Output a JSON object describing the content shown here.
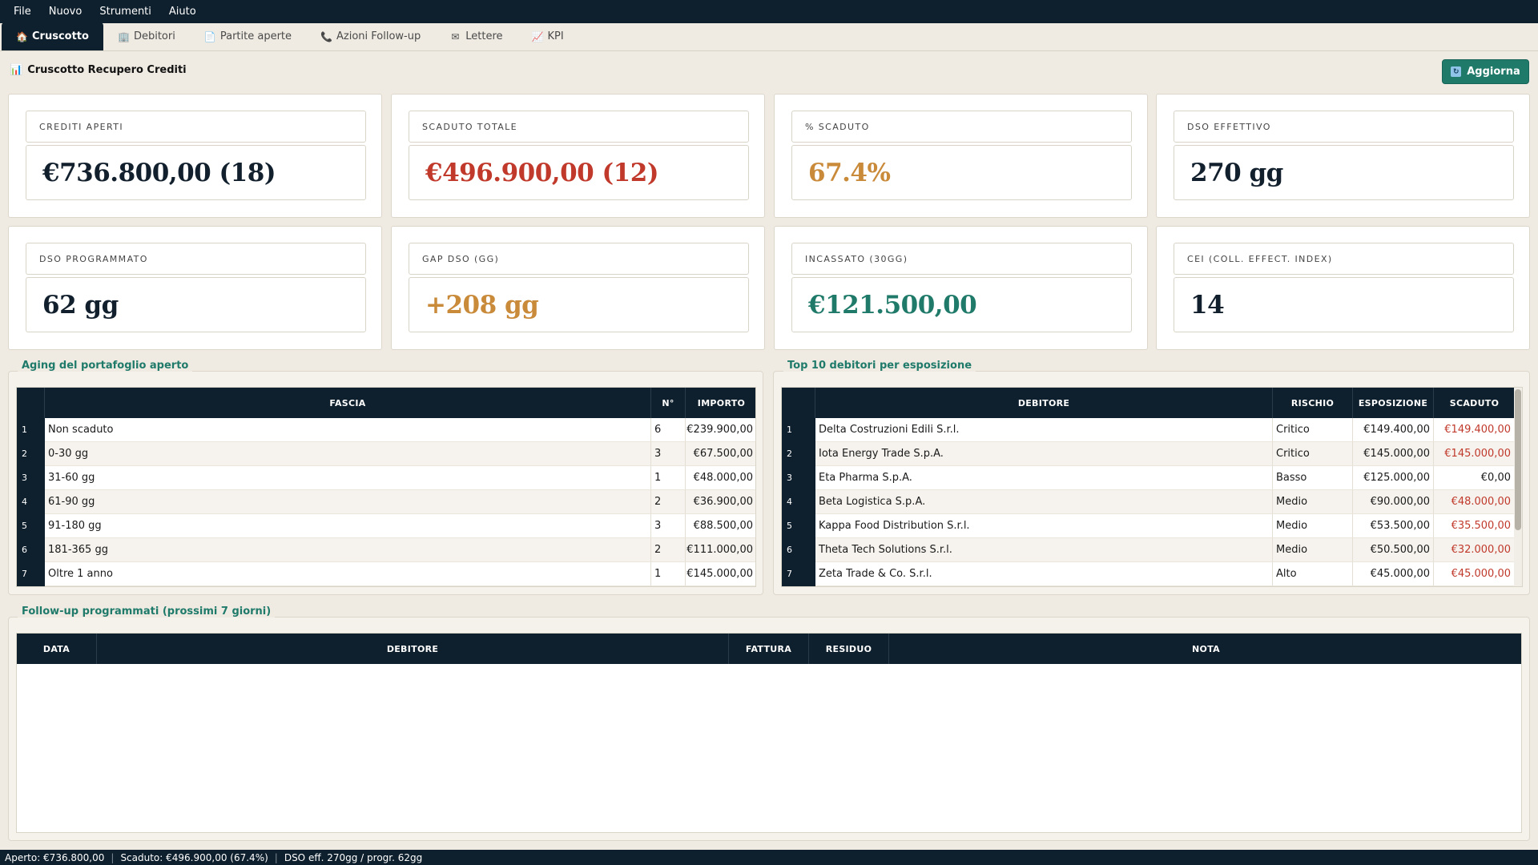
{
  "menu": [
    "File",
    "Nuovo",
    "Strumenti",
    "Aiuto"
  ],
  "tabs": [
    {
      "label": "Cruscotto",
      "icon": "🏠"
    },
    {
      "label": "Debitori",
      "icon": "🏢"
    },
    {
      "label": "Partite aperte",
      "icon": "📄"
    },
    {
      "label": "Azioni Follow-up",
      "icon": "📞"
    },
    {
      "label": "Lettere",
      "icon": "✉"
    },
    {
      "label": "KPI",
      "icon": "📈"
    }
  ],
  "header": {
    "title": "Cruscotto Recupero Crediti",
    "title_icon": "📊",
    "refresh_label": "Aggiorna",
    "refresh_icon": "🔄"
  },
  "kpis": [
    {
      "label": "CREDITI APERTI",
      "value": "€736.800,00  (18)",
      "color": "#12202e"
    },
    {
      "label": "SCADUTO TOTALE",
      "value": "€496.900,00  (12)",
      "color": "#c0392b"
    },
    {
      "label": "% SCADUTO",
      "value": "67.4%",
      "color": "#c98a3a"
    },
    {
      "label": "DSO EFFETTIVO",
      "value": "270 gg",
      "color": "#12202e"
    },
    {
      "label": "DSO PROGRAMMATO",
      "value": "62 gg",
      "color": "#12202e"
    },
    {
      "label": "GAP DSO (GG)",
      "value": "+208 gg",
      "color": "#c98a3a"
    },
    {
      "label": "INCASSATO (30GG)",
      "value": "€121.500,00",
      "color": "#1f7a6a"
    },
    {
      "label": "CEI (COLL. EFFECT. INDEX)",
      "value": "14",
      "color": "#12202e"
    }
  ],
  "aging": {
    "title": "Aging del portafoglio aperto",
    "columns": [
      "FASCIA",
      "N°",
      "IMPORTO"
    ],
    "rows": [
      {
        "n": "1",
        "fascia": "Non scaduto",
        "count": "6",
        "importo": "€239.900,00"
      },
      {
        "n": "2",
        "fascia": "0-30 gg",
        "count": "3",
        "importo": "€67.500,00"
      },
      {
        "n": "3",
        "fascia": "31-60 gg",
        "count": "1",
        "importo": "€48.000,00"
      },
      {
        "n": "4",
        "fascia": "61-90 gg",
        "count": "2",
        "importo": "€36.900,00"
      },
      {
        "n": "5",
        "fascia": "91-180 gg",
        "count": "3",
        "importo": "€88.500,00"
      },
      {
        "n": "6",
        "fascia": "181-365 gg",
        "count": "2",
        "importo": "€111.000,00"
      },
      {
        "n": "7",
        "fascia": "Oltre 1 anno",
        "count": "1",
        "importo": "€145.000,00"
      }
    ]
  },
  "top_debtors": {
    "title": "Top 10 debitori per esposizione",
    "columns": [
      "DEBITORE",
      "RISCHIO",
      "ESPOSIZIONE",
      "SCADUTO"
    ],
    "rows": [
      {
        "n": "1",
        "debitore": "Delta Costruzioni Edili S.r.l.",
        "rischio": "Critico",
        "esposizione": "€149.400,00",
        "scaduto": "€149.400,00",
        "overdue": true
      },
      {
        "n": "2",
        "debitore": "Iota Energy Trade S.p.A.",
        "rischio": "Critico",
        "esposizione": "€145.000,00",
        "scaduto": "€145.000,00",
        "overdue": true
      },
      {
        "n": "3",
        "debitore": "Eta Pharma S.p.A.",
        "rischio": "Basso",
        "esposizione": "€125.000,00",
        "scaduto": "€0,00",
        "overdue": false
      },
      {
        "n": "4",
        "debitore": "Beta Logistica S.p.A.",
        "rischio": "Medio",
        "esposizione": "€90.000,00",
        "scaduto": "€48.000,00",
        "overdue": true
      },
      {
        "n": "5",
        "debitore": "Kappa Food Distribution S.r.l.",
        "rischio": "Medio",
        "esposizione": "€53.500,00",
        "scaduto": "€35.500,00",
        "overdue": true
      },
      {
        "n": "6",
        "debitore": "Theta Tech Solutions S.r.l.",
        "rischio": "Medio",
        "esposizione": "€50.500,00",
        "scaduto": "€32.000,00",
        "overdue": true
      },
      {
        "n": "7",
        "debitore": "Zeta Trade & Co. S.r.l.",
        "rischio": "Alto",
        "esposizione": "€45.000,00",
        "scaduto": "€45.000,00",
        "overdue": true
      }
    ]
  },
  "followup": {
    "title": "Follow-up programmati (prossimi 7 giorni)",
    "columns": [
      "DATA",
      "DEBITORE",
      "FATTURA",
      "RESIDUO",
      "NOTA"
    ]
  },
  "status": [
    "Aperto: €736.800,00",
    "Scaduto: €496.900,00 (67.4%)",
    "DSO eff. 270gg / progr. 62gg"
  ]
}
